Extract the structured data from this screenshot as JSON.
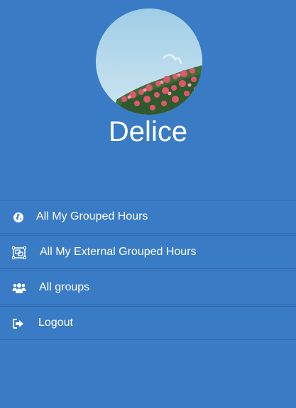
{
  "profile": {
    "name": "Delice"
  },
  "menu": {
    "items": [
      {
        "label": "All My Grouped Hours",
        "icon": "globe-icon"
      },
      {
        "label": "All My External Grouped Hours",
        "icon": "object-group-icon"
      },
      {
        "label": "All groups",
        "icon": "users-icon"
      },
      {
        "label": "Logout",
        "icon": "sign-out-icon"
      }
    ]
  },
  "colors": {
    "background": "#3a7bc6",
    "divider": "#2f6aae",
    "text": "#ffffff"
  }
}
